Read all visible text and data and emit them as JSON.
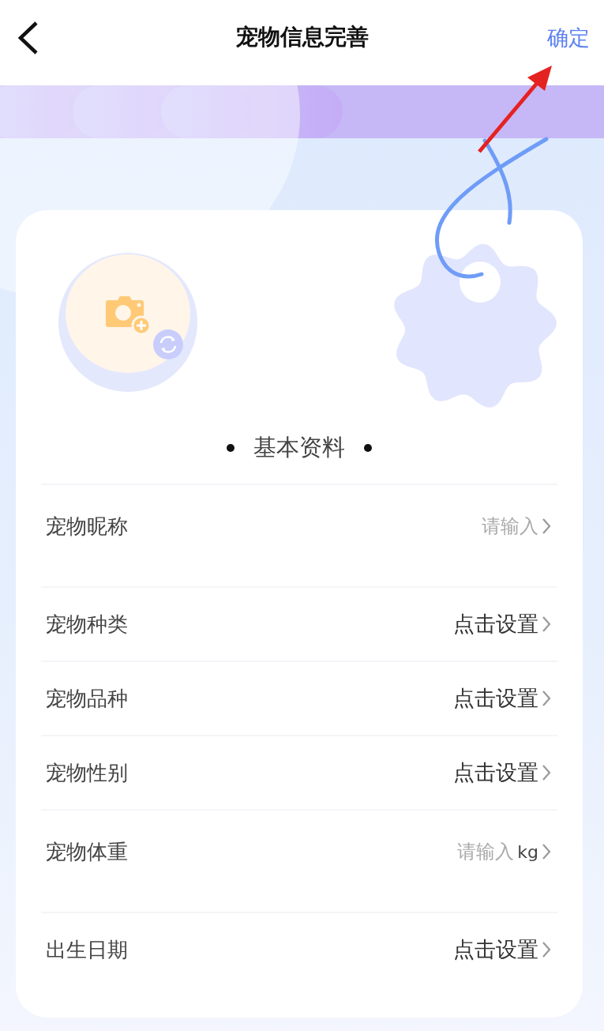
{
  "header": {
    "title": "宠物信息完善",
    "confirm": "确定"
  },
  "section_title": "基本资料",
  "fields": [
    {
      "kind": "input",
      "label": "宠物昵称",
      "placeholder": "请输入"
    },
    {
      "kind": "select",
      "label": "宠物种类",
      "value": "点击设置"
    },
    {
      "kind": "select",
      "label": "宠物品种",
      "value": "点击设置"
    },
    {
      "kind": "select",
      "label": "宠物性别",
      "value": "点击设置"
    },
    {
      "kind": "input",
      "label": "宠物体重",
      "placeholder": "请输入",
      "unit": "kg"
    },
    {
      "kind": "select",
      "label": "出生日期",
      "value": "点击设置"
    }
  ]
}
